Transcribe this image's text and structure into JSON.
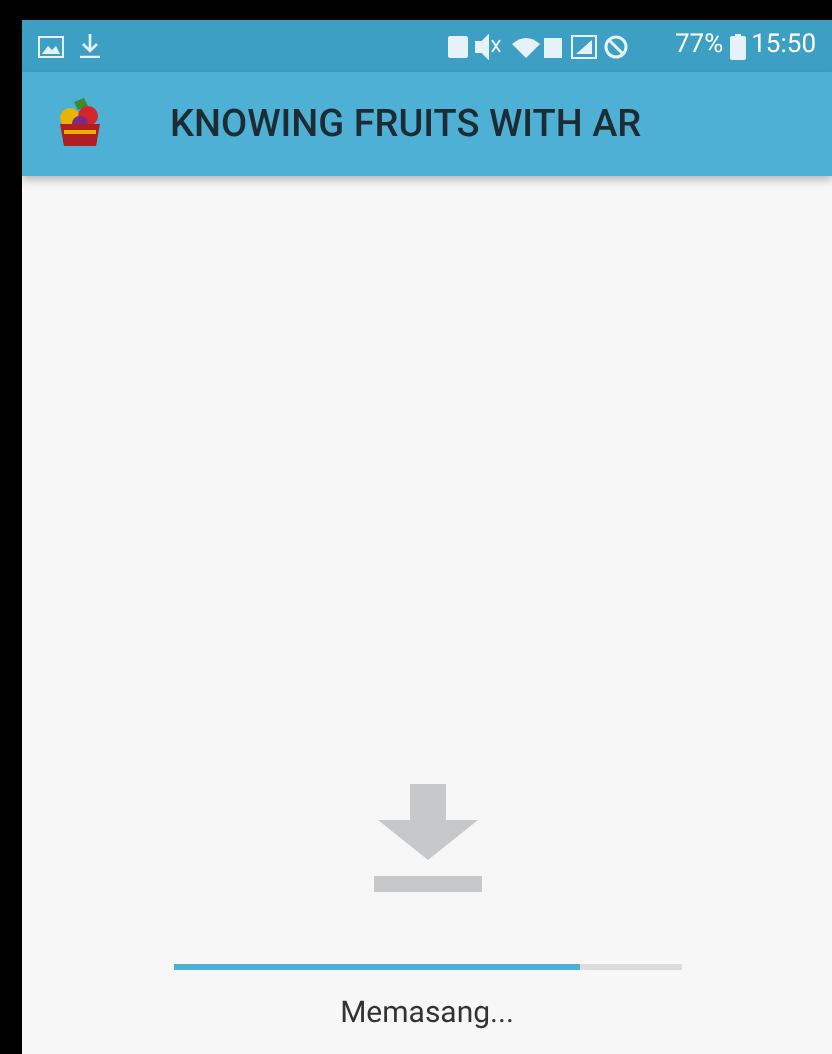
{
  "status_bar": {
    "battery": "77%",
    "time": "15:50"
  },
  "app_bar": {
    "title": "KNOWING FRUITS WITH AR"
  },
  "install": {
    "level": 0.8,
    "status": "Memasang..."
  }
}
